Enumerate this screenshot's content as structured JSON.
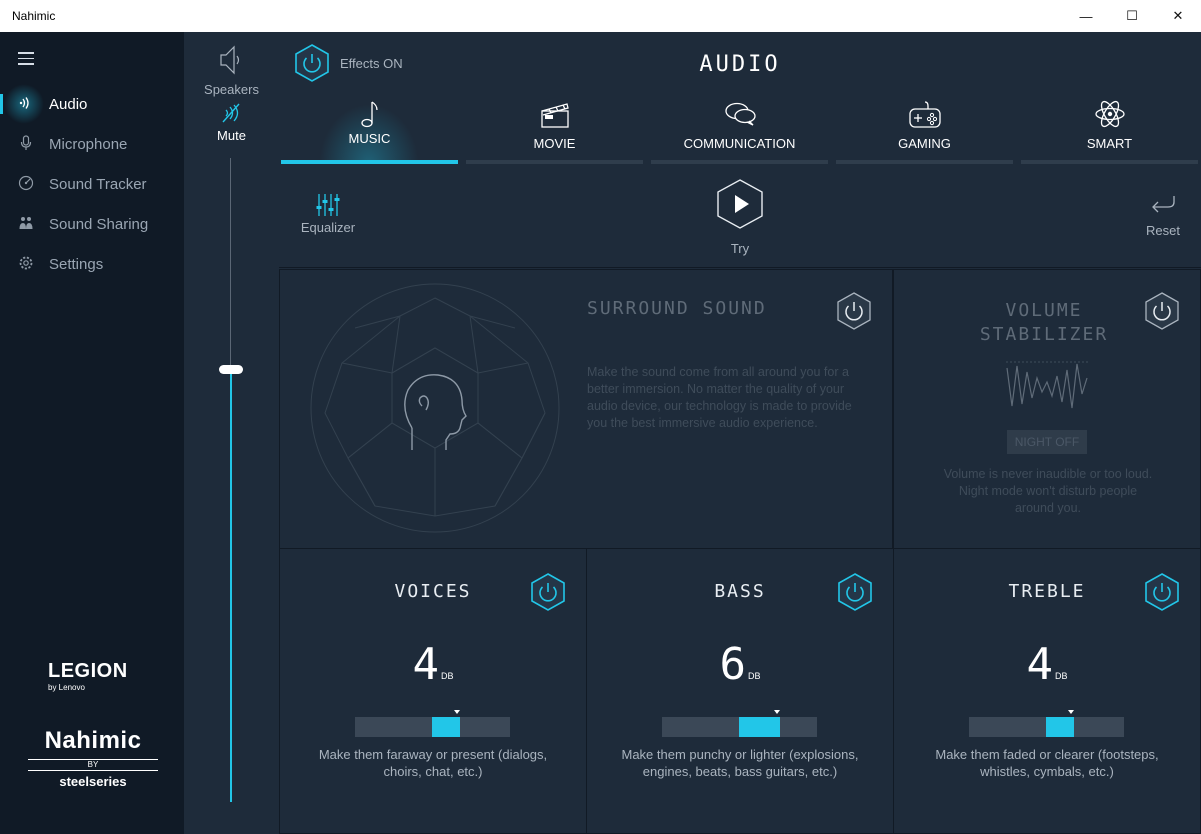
{
  "window": {
    "title": "Nahimic",
    "minimize": "—",
    "maximize": "☐",
    "close": "✕"
  },
  "nav": {
    "items": [
      {
        "label": "Audio",
        "icon": "audio-wave-icon",
        "active": true
      },
      {
        "label": "Microphone",
        "icon": "microphone-icon",
        "active": false
      },
      {
        "label": "Sound Tracker",
        "icon": "sound-tracker-icon",
        "active": false
      },
      {
        "label": "Sound Sharing",
        "icon": "sound-sharing-icon",
        "active": false
      },
      {
        "label": "Settings",
        "icon": "settings-gear-icon",
        "active": false
      }
    ],
    "brand1": {
      "name": "LEGION",
      "sub": "by Lenovo"
    },
    "brand2": {
      "name": "Nahimic",
      "by": "BY",
      "sub": "steelseries"
    }
  },
  "volume": {
    "device_label": "Speakers",
    "mute_label": "Mute",
    "level": 0.67
  },
  "header": {
    "effects_label": "Effects ON",
    "title": "AUDIO"
  },
  "tabs": [
    {
      "label": "MUSIC",
      "icon": "music-note-icon",
      "active": true
    },
    {
      "label": "MOVIE",
      "icon": "clapperboard-icon",
      "active": false
    },
    {
      "label": "COMMUNICATION",
      "icon": "chat-bubbles-icon",
      "active": false
    },
    {
      "label": "GAMING",
      "icon": "gamepad-icon",
      "active": false
    },
    {
      "label": "SMART",
      "icon": "atom-icon",
      "active": false
    }
  ],
  "toolbar": {
    "equalizer_label": "Equalizer",
    "try_label": "Try",
    "reset_label": "Reset"
  },
  "surround": {
    "title": "SURROUND SOUND",
    "description": "Make the sound come from all around you for a better immersion. No matter the quality of your audio device, our technology is made to provide you the best immersive audio experience."
  },
  "stabilizer": {
    "title_line1": "VOLUME",
    "title_line2": "STABILIZER",
    "night_label": "NIGHT OFF",
    "description": "Volume is never inaudible or too loud. Night mode won't disturb people around you."
  },
  "sliders": [
    {
      "title": "VOICES",
      "value": "4",
      "unit": "DB",
      "level": 0.5,
      "description": "Make them faraway or present (dialogs, choirs, chat, etc.)"
    },
    {
      "title": "BASS",
      "value": "6",
      "unit": "DB",
      "level": 0.5,
      "description": "Make them punchy or lighter (explosions, engines, beats, bass guitars, etc.)"
    },
    {
      "title": "TREBLE",
      "value": "4",
      "unit": "DB",
      "level": 0.5,
      "description": "Make them faded or clearer (footsteps, whistles, cymbals, etc.)"
    }
  ],
  "colors": {
    "accent": "#22c6e8",
    "background": "#1e2b3a",
    "nav": "#101a26"
  }
}
